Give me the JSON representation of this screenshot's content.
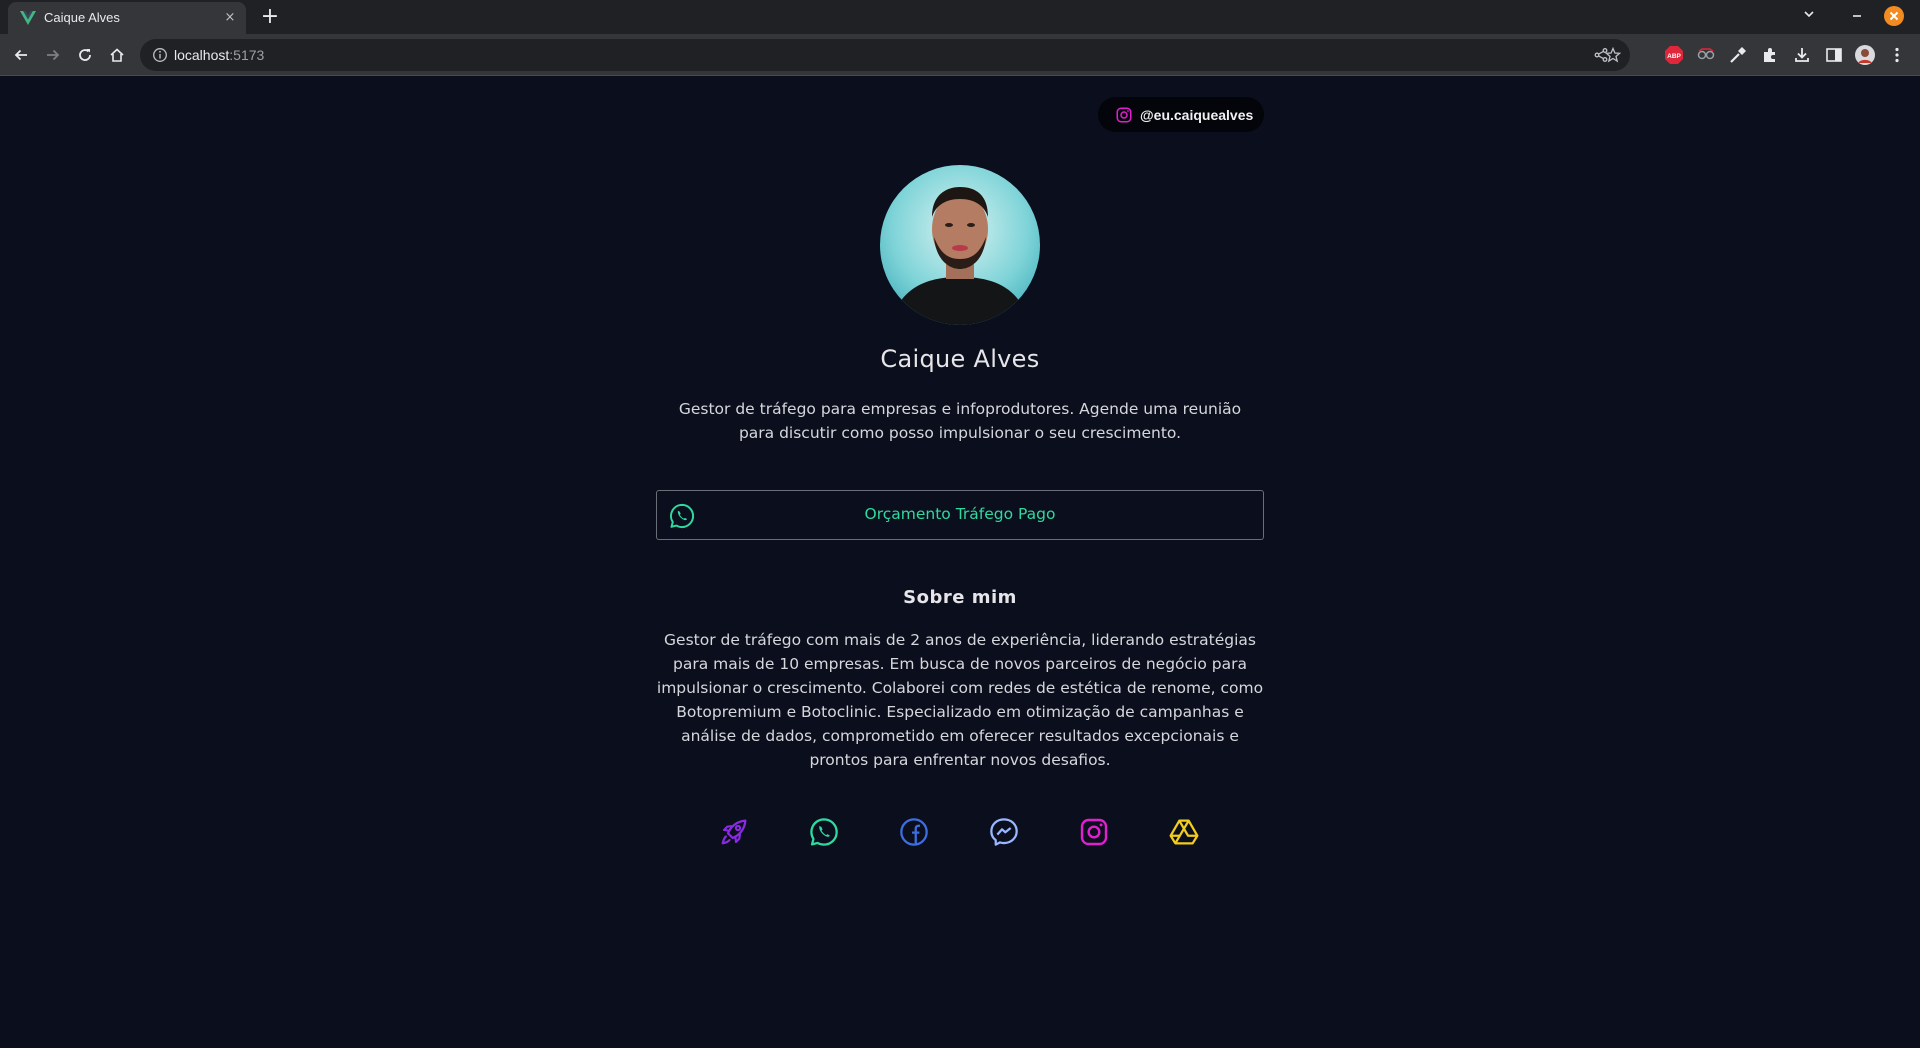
{
  "browser": {
    "tab_title": "Caique Alves",
    "tab_close": "×",
    "new_tab": "+",
    "url_host": "localhost",
    "url_port": ":5173",
    "extension_abp_label": "ABP"
  },
  "page": {
    "instagram_handle": "@eu.caiquealves",
    "name": "Caique Alves",
    "tagline": "Gestor de tráfego para empresas e infoprodutores. Agende uma reunião para discutir como posso impulsionar o seu crescimento.",
    "cta_label": "Orçamento Tráfego Pago",
    "about_title": "Sobre mim",
    "about_text": "Gestor de tráfego com mais de 2 anos de experiência, liderando estratégias para mais de 10 empresas. Em busca de novos parceiros de negócio para impulsionar o crescimento. Colaborei com redes de estética de renome, como Botopremium e Botoclinic. Especializado em otimização de campanhas e análise de dados, comprometido em oferecer resultados excepcionais e prontos para enfrentar novos desafios."
  },
  "social_links": [
    {
      "icon": "rocket-icon",
      "color": "#8a2be2"
    },
    {
      "icon": "whatsapp-icon",
      "color": "#2fd9a0"
    },
    {
      "icon": "facebook-icon",
      "color": "#3b6fe0"
    },
    {
      "icon": "messenger-icon",
      "color": "#9ab6ff"
    },
    {
      "icon": "instagram-icon",
      "color": "#e21fd0"
    },
    {
      "icon": "google-drive-icon",
      "color": "#f2cc1f"
    }
  ],
  "colors": {
    "background": "#0b0e1c",
    "accent_green": "#2fd9a0",
    "instagram_pink": "#e21fd0"
  }
}
